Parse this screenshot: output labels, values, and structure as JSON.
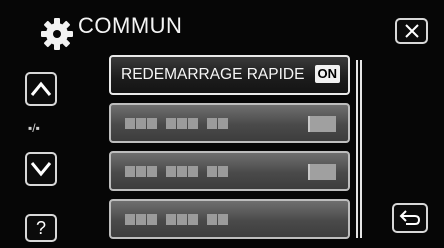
{
  "header": {
    "title": "COMMUN",
    "icon": "gear-icon"
  },
  "nav": {
    "close_icon": "close-icon",
    "up_icon": "chevron-up-icon",
    "down_icon": "chevron-down-icon",
    "page_indicator": "▪/▪",
    "help_label": "?",
    "back_icon": "return-arrow-icon"
  },
  "menu": {
    "items": [
      {
        "label": "REDEMARRAGE RAPIDE",
        "value": "ON",
        "active": true
      },
      {
        "label": "",
        "value": "",
        "active": false
      },
      {
        "label": "",
        "value": "",
        "active": false
      },
      {
        "label": "",
        "value": "",
        "active": false
      }
    ]
  },
  "colors": {
    "accent": "#ffffff",
    "background": "#060606",
    "item_bg": "#555555"
  }
}
